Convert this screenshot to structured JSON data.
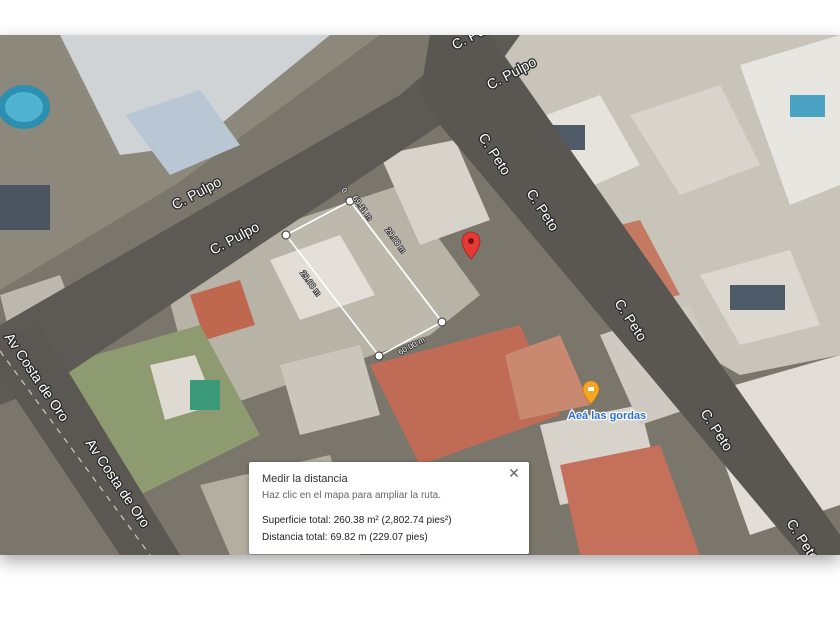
{
  "streets": {
    "pulpo_top": "C. Pulpo",
    "pulpo_top_edge": "C. Pu",
    "pulpo_mid": "C. Pulpo",
    "pulpo_low": "C. Pulpo",
    "peto_1": "C. Peto",
    "peto_2": "C. Peto",
    "peto_3": "C. Peto",
    "peto_4": "C. Peto",
    "peto_5": "C. Peto",
    "costa_1": "Av Costa de Oro",
    "costa_2": "Av Costa de Oro"
  },
  "poi": {
    "name": "Aeá las gordas",
    "icon": "restaurant-pin-icon",
    "color": "#f5a623"
  },
  "marker": {
    "icon": "location-pin-icon",
    "color": "#e53935"
  },
  "measurement": {
    "side_top": "69.11 m",
    "side_top_small": "0",
    "side_inner": "29.08 m",
    "side_left": "29.08 m",
    "side_bottom": "60.00 m"
  },
  "popup": {
    "title": "Medir la distancia",
    "subtitle": "Haz clic en el mapa para ampliar la ruta.",
    "area": "Superficie total: 260.38 m² (2,802.74 pies²)",
    "distance": "Distancia total: 69.82 m (229.07 pies)",
    "close_icon": "close-icon"
  }
}
